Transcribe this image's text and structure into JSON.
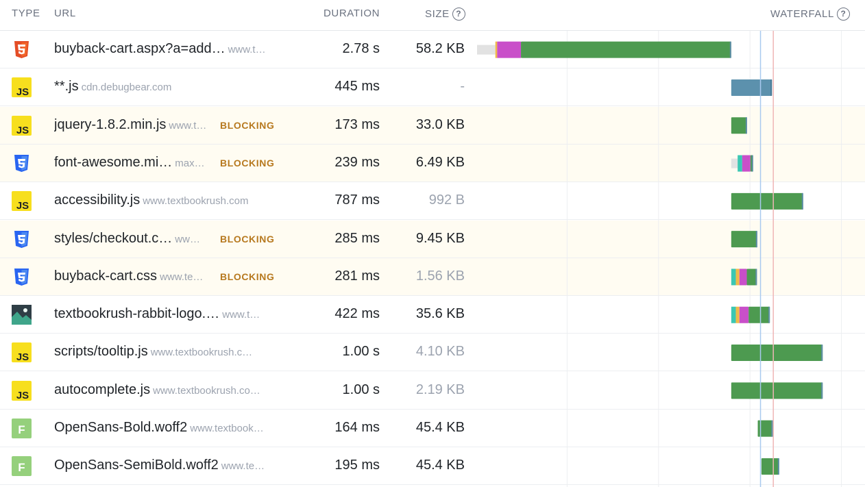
{
  "header": {
    "type": "TYPE",
    "url": "URL",
    "duration": "DURATION",
    "size": "SIZE",
    "waterfall": "WATERFALL",
    "help_glyph": "?"
  },
  "colors": {
    "waiting": "#e2e2e2",
    "dns": "#f0b94a",
    "connect": "#3cc7b3",
    "ssl": "#c94fc9",
    "download": "#4d9a50",
    "script": "#5c91ad",
    "blocking_bg": "#fffcf2",
    "blocking_text": "#b7791f",
    "marker_blue": "#a9c9ef",
    "marker_red": "#efb6b6"
  },
  "rows": [
    {
      "icon": "html-icon",
      "name": "buyback-cart.aspx?a=add…",
      "host": "www.t…",
      "blocking": "",
      "duration": "2.78 s",
      "size": "58.2 KB",
      "size_muted": false,
      "bars": [
        [
          "waiting",
          0,
          0.2
        ],
        [
          "dns",
          0.2,
          0.22
        ],
        [
          "ssl",
          0.22,
          0.48
        ],
        [
          "download",
          0.48,
          2.78
        ]
      ]
    },
    {
      "icon": "js-icon",
      "name": "**.js",
      "host": "cdn.debugbear.com",
      "blocking": "",
      "duration": "445 ms",
      "size": "-",
      "size_muted": true,
      "bars": [
        [
          "script",
          2.78,
          3.225
        ]
      ]
    },
    {
      "icon": "js-icon",
      "name": "jquery-1.8.2.min.js",
      "host": "www.t…",
      "blocking": "BLOCKING",
      "duration": "173 ms",
      "size": "33.0 KB",
      "size_muted": false,
      "bars": [
        [
          "download",
          2.78,
          2.953
        ]
      ]
    },
    {
      "icon": "css-icon",
      "name": "font-awesome.mi…",
      "host": "max…",
      "blocking": "BLOCKING",
      "duration": "239 ms",
      "size": "6.49 KB",
      "size_muted": false,
      "bars": [
        [
          "waiting",
          2.78,
          2.85
        ],
        [
          "connect",
          2.85,
          2.9
        ],
        [
          "ssl",
          2.9,
          2.99
        ],
        [
          "download",
          2.99,
          3.019
        ]
      ]
    },
    {
      "icon": "js-icon",
      "name": "accessibility.js",
      "host": "www.textbookrush.com",
      "blocking": "",
      "duration": "787 ms",
      "size": "992 B",
      "size_muted": true,
      "bars": [
        [
          "download",
          2.78,
          3.567
        ]
      ]
    },
    {
      "icon": "css-icon",
      "name": "styles/checkout.c…",
      "host": "ww…",
      "blocking": "BLOCKING",
      "duration": "285 ms",
      "size": "9.45 KB",
      "size_muted": false,
      "bars": [
        [
          "download",
          2.78,
          3.065
        ]
      ]
    },
    {
      "icon": "css-icon",
      "name": "buyback-cart.css",
      "host": "www.te…",
      "blocking": "BLOCKING",
      "duration": "281 ms",
      "size": "1.56 KB",
      "size_muted": true,
      "bars": [
        [
          "connect",
          2.78,
          2.83
        ],
        [
          "dns",
          2.83,
          2.87
        ],
        [
          "ssl",
          2.87,
          2.95
        ],
        [
          "download",
          2.95,
          3.061
        ]
      ]
    },
    {
      "icon": "image-icon",
      "name": "textbookrush-rabbit-logo.…",
      "host": "www.t…",
      "blocking": "",
      "duration": "422 ms",
      "size": "35.6 KB",
      "size_muted": false,
      "bars": [
        [
          "connect",
          2.78,
          2.83
        ],
        [
          "dns",
          2.83,
          2.87
        ],
        [
          "ssl",
          2.87,
          2.97
        ],
        [
          "download",
          2.97,
          3.202
        ]
      ]
    },
    {
      "icon": "js-icon",
      "name": "scripts/tooltip.js",
      "host": "www.textbookrush.c…",
      "blocking": "",
      "duration": "1.00 s",
      "size": "4.10 KB",
      "size_muted": true,
      "bars": [
        [
          "download",
          2.78,
          3.78
        ]
      ]
    },
    {
      "icon": "js-icon",
      "name": "autocomplete.js",
      "host": "www.textbookrush.co…",
      "blocking": "",
      "duration": "1.00 s",
      "size": "2.19 KB",
      "size_muted": true,
      "bars": [
        [
          "download",
          2.78,
          3.78
        ]
      ]
    },
    {
      "icon": "font-icon",
      "name": "OpenSans-Bold.woff2",
      "host": "www.textbook…",
      "blocking": "",
      "duration": "164 ms",
      "size": "45.4 KB",
      "size_muted": false,
      "bars": [
        [
          "download",
          3.07,
          3.234
        ]
      ]
    },
    {
      "icon": "font-icon",
      "name": "OpenSans-SemiBold.woff2",
      "host": "www.te…",
      "blocking": "",
      "duration": "195 ms",
      "size": "45.4 KB",
      "size_muted": false,
      "bars": [
        [
          "download",
          3.11,
          3.305
        ]
      ]
    }
  ],
  "markers": {
    "blue": 3.1,
    "red": 3.24
  }
}
